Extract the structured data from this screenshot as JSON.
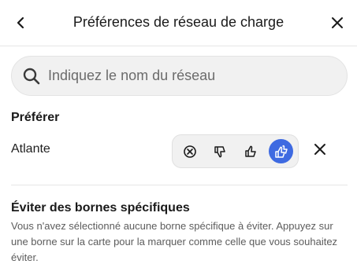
{
  "header": {
    "title": "Préférences de réseau de charge",
    "back_icon": "chevron-left-icon",
    "close_icon": "close-icon"
  },
  "search": {
    "placeholder": "Indiquez le nom du réseau",
    "value": "",
    "icon": "search-icon"
  },
  "prefer_section": {
    "title": "Préférer",
    "network": {
      "name": "Atlante",
      "options": [
        {
          "icon": "block-icon",
          "selected": false
        },
        {
          "icon": "thumbs-down-icon",
          "selected": false
        },
        {
          "icon": "thumbs-up-icon",
          "selected": false
        },
        {
          "icon": "thumbs-up-double-icon",
          "selected": true
        }
      ],
      "remove_icon": "close-icon"
    }
  },
  "avoid_section": {
    "title": "Éviter des bornes spécifiques",
    "description": "Vous n'avez sélectionné aucune borne spécifique à éviter. Appuyez sur une borne sur la carte pour la marquer comme celle que vous souhaitez éviter."
  },
  "colors": {
    "accent": "#3e6ae1",
    "field_bg": "#f1f1f1",
    "divider": "#e6e6e6"
  }
}
